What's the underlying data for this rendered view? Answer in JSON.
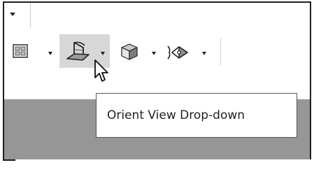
{
  "tooltip": {
    "text": "Orient View Drop-down"
  },
  "toolbar": {
    "items": [
      {
        "icon": "view-layout-icon",
        "has_dropdown": true
      },
      {
        "icon": "orient-view-icon",
        "has_dropdown": true,
        "hovered": true
      },
      {
        "icon": "display-style-cube-icon",
        "has_dropdown": true
      },
      {
        "icon": "hide-show-items-icon",
        "has_dropdown": true
      }
    ]
  },
  "colors": {
    "hover_highlight": "#d7d7d7",
    "viewport_background": "#969696",
    "tooltip_border": "#555555"
  }
}
